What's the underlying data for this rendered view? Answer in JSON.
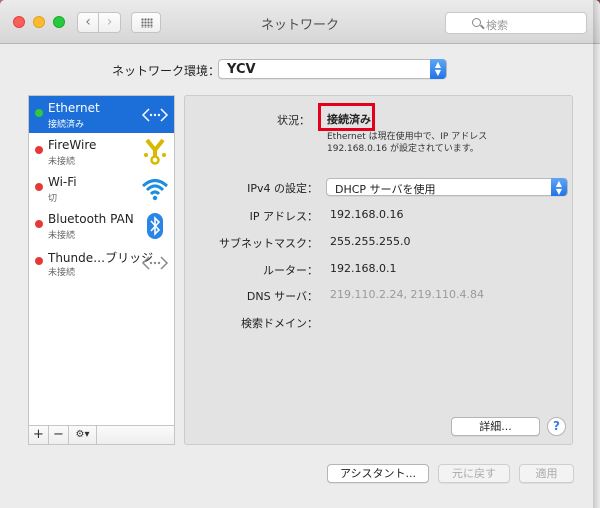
{
  "window": {
    "title": "ネットワーク",
    "search_placeholder": "検索"
  },
  "location": {
    "label": "ネットワーク環境：",
    "value": "YCV"
  },
  "services": [
    {
      "name": "Ethernet",
      "status": "接続済み",
      "state": "green",
      "icon": "ethernet-icon",
      "selected": true
    },
    {
      "name": "FireWire",
      "status": "未接続",
      "state": "red",
      "icon": "firewire-icon",
      "selected": false
    },
    {
      "name": "Wi-Fi",
      "status": "切",
      "state": "red",
      "icon": "wifi-icon",
      "selected": false
    },
    {
      "name": "Bluetooth PAN",
      "status": "未接続",
      "state": "red",
      "icon": "bluetooth-icon",
      "selected": false
    },
    {
      "name": "Thunde…ブリッジ",
      "status": "未接続",
      "state": "red",
      "icon": "thunderbolt-bridge-icon",
      "selected": false
    }
  ],
  "sidebar_toolbar": {
    "add": "+",
    "remove": "−",
    "gear": "⚙︎▾"
  },
  "detail": {
    "status_label": "状況：",
    "status_value": "接続済み",
    "status_desc_line1": "Ethernet は現在使用中で、IP アドレス",
    "status_desc_line2": "192.168.0.16 が設定されています。",
    "ipv4_label": "IPv4 の設定：",
    "ipv4_value": "DHCP サーバを使用",
    "ip_label": "IP アドレス：",
    "ip_value": "192.168.0.16",
    "subnet_label": "サブネットマスク：",
    "subnet_value": "255.255.255.0",
    "router_label": "ルーター：",
    "router_value": "192.168.0.1",
    "dns_label": "DNS サーバ：",
    "dns_value": "219.110.2.24, 219.110.4.84",
    "domain_label": "検索ドメイン："
  },
  "buttons": {
    "advanced": "詳細...",
    "help": "?",
    "assistant": "アシスタント...",
    "revert": "元に戻す",
    "apply": "適用"
  },
  "colors": {
    "accent": "#1c6fd9",
    "connected": "#2fc93d",
    "disconnected": "#e73838",
    "highlight_box": "#e3001b"
  }
}
